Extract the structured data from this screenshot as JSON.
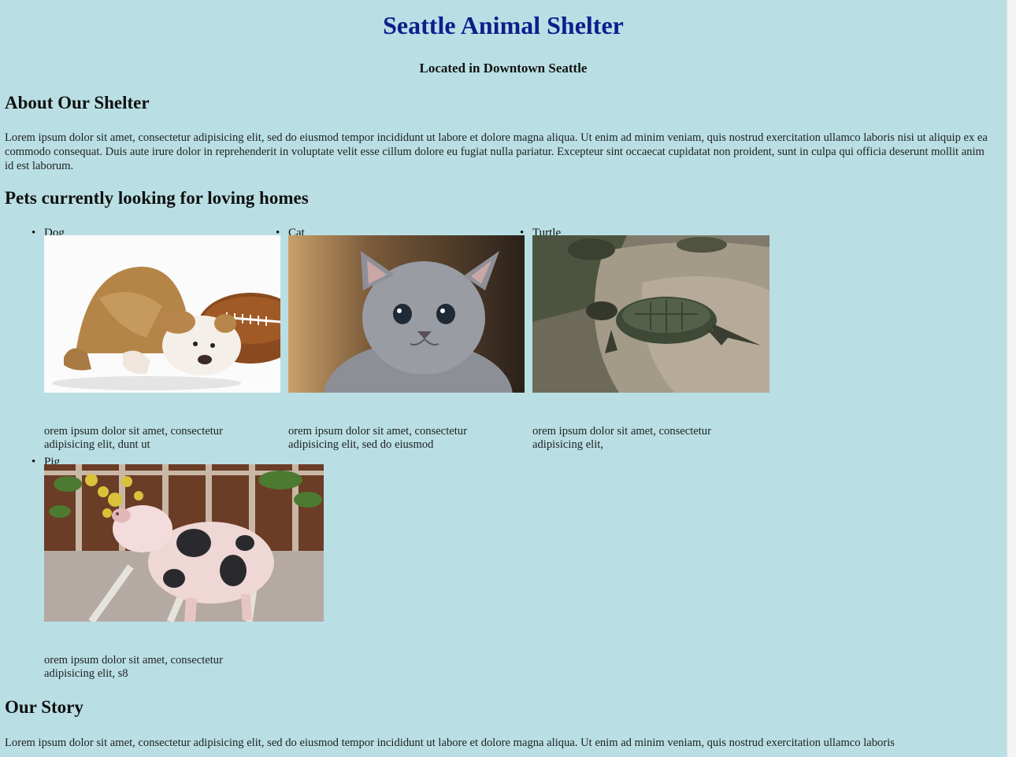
{
  "header": {
    "title": "Seattle Animal Shelter",
    "subtitle": "Located in Downtown Seattle"
  },
  "about": {
    "heading": "About Our Shelter",
    "text": "Lorem ipsum dolor sit amet, consectetur adipisicing elit, sed do eiusmod tempor incididunt ut labore et dolore magna aliqua. Ut enim ad minim veniam, quis nostrud exercitation ullamco laboris nisi ut aliquip ex ea commodo consequat. Duis aute irure dolor in reprehenderit in voluptate velit esse cillum dolore eu fugiat nulla pariatur. Excepteur sint occaecat cupidatat non proident, sunt in culpa qui officia deserunt mollit anim id est laborum."
  },
  "pets": {
    "heading": "Pets currently looking for loving homes",
    "bullet": "•",
    "items": [
      {
        "label": "Dog",
        "description": "orem ipsum dolor sit amet, consectetur adipisicing elit, dunt ut",
        "photo_icon": "bulldog-puppy-photo"
      },
      {
        "label": "Cat",
        "description": "orem ipsum dolor sit amet, consectetur adipisicing elit, sed do eiusmod",
        "photo_icon": "gray-kitten-photo"
      },
      {
        "label": "Turtle",
        "description": "orem ipsum dolor sit amet, consectetur adipisicing elit,",
        "photo_icon": "turtle-on-rock-photo"
      },
      {
        "label": "Pig",
        "description": "orem ipsum dolor sit amet, consectetur adipisicing elit, s8",
        "photo_icon": "spotted-piglet-photo"
      }
    ]
  },
  "story": {
    "heading": "Our Story",
    "text": "Lorem ipsum dolor sit amet, consectetur adipisicing elit, sed do eiusmod tempor incididunt ut labore et dolore magna aliqua. Ut enim ad minim veniam, quis nostrud exercitation ullamco laboris"
  },
  "colors": {
    "page_background": "#b9dfe4",
    "title": "#0f1d8c",
    "text": "#111111"
  }
}
